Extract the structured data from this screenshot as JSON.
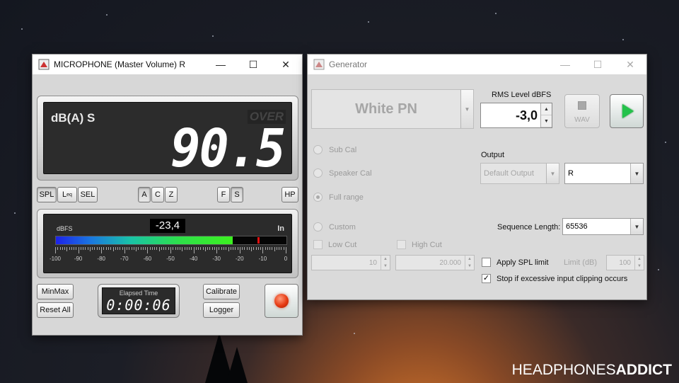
{
  "mic_window": {
    "title": "MICROPHONE (Master Volume) R",
    "display": {
      "weighting_label": "dB(A) S",
      "over_label": "OVER",
      "reading": "90.5"
    },
    "mode_buttons": [
      "SPL",
      "L",
      "SEL"
    ],
    "leq_subscript": "eq",
    "weighting_buttons": [
      "A",
      "C",
      "Z"
    ],
    "response_buttons": [
      "F",
      "S"
    ],
    "hp_button": "HP",
    "meter": {
      "scale_label": "dBFS",
      "input_label": "In",
      "level_readout": "-23,4",
      "level_dbfs": -23.4,
      "peak_dbfs": -12.5,
      "scale_ticks": [
        "-100",
        "-90",
        "-80",
        "-70",
        "-60",
        "-50",
        "-40",
        "-30",
        "-20",
        "-10",
        "0"
      ]
    },
    "minmax_button": "MinMax",
    "reset_button": "Reset All",
    "elapsed_label": "Elapsed Time",
    "elapsed_value": "0:00:06",
    "calibrate_button": "Calibrate",
    "logger_button": "Logger",
    "record_color": "#e63a12"
  },
  "gen_window": {
    "title": "Generator",
    "signal_select": "White PN",
    "rms_label": "RMS Level dBFS",
    "rms_value": "-3,0",
    "wav_label": "WAV",
    "play_color": "#23c24a",
    "radios": [
      {
        "label": "Sub Cal",
        "checked": false
      },
      {
        "label": "Speaker Cal",
        "checked": false
      },
      {
        "label": "Full range",
        "checked": true
      },
      {
        "label": "Custom",
        "checked": false
      }
    ],
    "output_label": "Output",
    "output_device": "Default Output",
    "output_channel": "R",
    "sequence_label": "Sequence Length:",
    "sequence_value": "65536",
    "low_cut_label": "Low Cut",
    "high_cut_label": "High Cut",
    "low_cut_value": "10",
    "high_cut_value": "20.000",
    "apply_spl_label": "Apply SPL limit",
    "limit_label": "Limit (dB)",
    "limit_value": "100",
    "stop_clipping_label": "Stop if excessive input clipping occurs"
  },
  "watermark": {
    "part1": "HEADPHONES",
    "part2": "ADDICT"
  }
}
